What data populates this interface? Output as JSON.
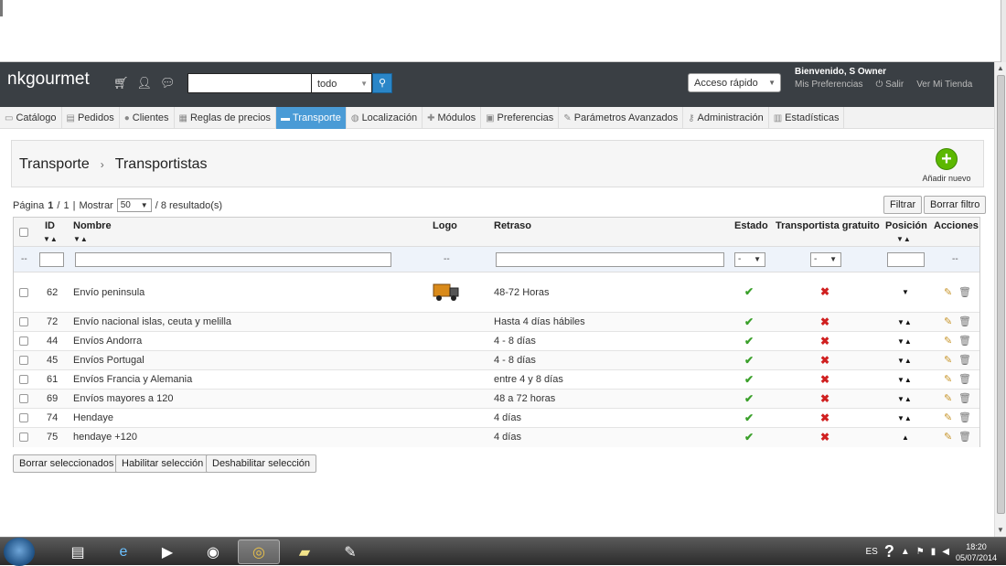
{
  "header": {
    "brand": "nkgourmet",
    "search_scope": "todo",
    "quick_access": "Acceso rápido",
    "welcome": "Bienvenido, S Owner",
    "prefs": "Mis Preferencias",
    "logout": "Salir",
    "view_shop": "Ver Mi Tienda"
  },
  "menu": [
    {
      "label": "Catálogo",
      "icon": "folder-icon"
    },
    {
      "label": "Pedidos",
      "icon": "orders-icon"
    },
    {
      "label": "Clientes",
      "icon": "customers-icon"
    },
    {
      "label": "Reglas de precios",
      "icon": "price-rules-icon"
    },
    {
      "label": "Transporte",
      "icon": "truck-icon"
    },
    {
      "label": "Localización",
      "icon": "globe-icon"
    },
    {
      "label": "Módulos",
      "icon": "puzzle-icon"
    },
    {
      "label": "Preferencias",
      "icon": "preferences-icon"
    },
    {
      "label": "Parámetros Avanzados",
      "icon": "wrench-icon"
    },
    {
      "label": "Administración",
      "icon": "key-icon"
    },
    {
      "label": "Estadísticas",
      "icon": "stats-icon"
    }
  ],
  "breadcrumb": {
    "parent": "Transporte",
    "current": "Transportistas"
  },
  "toolbar": {
    "add_new": "Añadir nuevo"
  },
  "pager": {
    "page_label": "Página",
    "page": "1",
    "pages": "1",
    "show": "Mostrar",
    "per_page": "50",
    "results": "/ 8 resultado(s)"
  },
  "filters": {
    "filter_btn": "Filtrar",
    "reset_btn": "Borrar filtro",
    "any": "--",
    "dash": "-"
  },
  "columns": {
    "id": "ID",
    "name": "Nombre",
    "logo": "Logo",
    "delay": "Retraso",
    "status": "Estado",
    "free": "Transportista gratuito",
    "position": "Posición",
    "actions": "Acciones"
  },
  "rows": [
    {
      "id": "62",
      "name": "Envío peninsula",
      "delay": "48-72 Horas"
    },
    {
      "id": "72",
      "name": "Envío nacional islas, ceuta y melilla",
      "delay": "Hasta 4 días hábiles"
    },
    {
      "id": "44",
      "name": "Envíos Andorra",
      "delay": "4 - 8 días"
    },
    {
      "id": "45",
      "name": "Envíos Portugal",
      "delay": "4 - 8 días"
    },
    {
      "id": "61",
      "name": "Envíos Francia y Alemania",
      "delay": "entre 4 y 8 días"
    },
    {
      "id": "69",
      "name": "Envíos mayores a 120",
      "delay": "48 a 72 horas"
    },
    {
      "id": "74",
      "name": "Hendaye",
      "delay": "4 días"
    },
    {
      "id": "75",
      "name": "hendaye +120",
      "delay": "4 días"
    }
  ],
  "bulk": {
    "delete": "Borrar seleccionados",
    "enable": "Habilitar selección",
    "disable": "Deshabilitar selección"
  },
  "taskbar": {
    "lang": "ES",
    "time": "18:20",
    "date": "05/07/2014"
  },
  "colors": {
    "header_bg": "#3a3f44",
    "active_tab": "#4a9bd6",
    "ok": "#3aa02a",
    "no": "#d02020"
  }
}
